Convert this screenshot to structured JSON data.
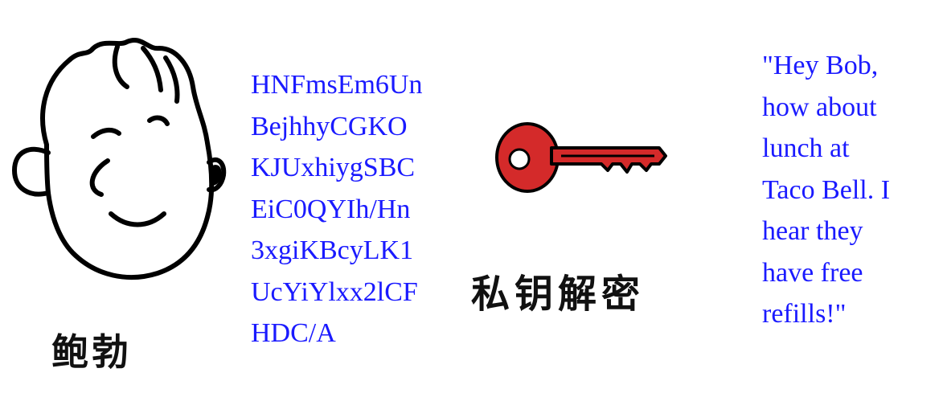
{
  "sender": {
    "name": "鲍勃",
    "icon": "cartoon-face-icon"
  },
  "ciphertext": {
    "lines": [
      "HNFmsEm6Un",
      "BejhhyCGKO",
      "KJUxhiygSBC",
      "EiC0QYIh/Hn",
      "3xgiKBcyLK1",
      "UcYiYlxx2lCF",
      "HDC/A"
    ],
    "color": "#1a1aff"
  },
  "decryption": {
    "icon": "key-icon",
    "key_color": "#d42a2a",
    "label": "私钥解密"
  },
  "plaintext": {
    "lines": [
      "\"Hey Bob,",
      "how about",
      "lunch at",
      "Taco Bell. I",
      "hear they",
      "have free",
      "refills!\""
    ],
    "color": "#1a1aff"
  }
}
